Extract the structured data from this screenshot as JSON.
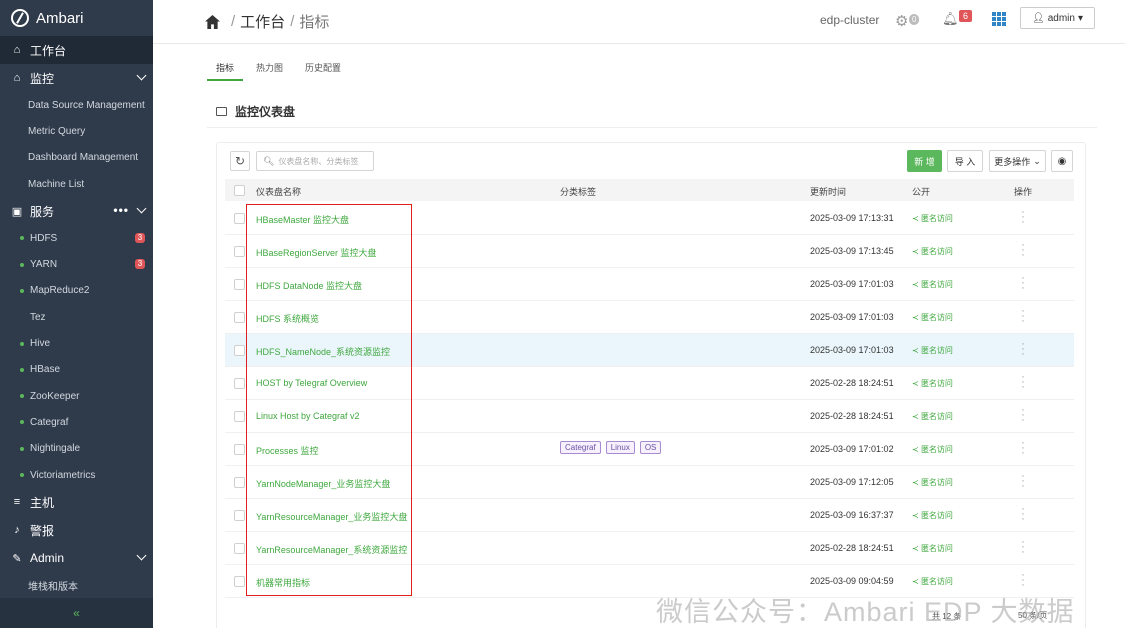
{
  "sidebar": {
    "brand": "Ambari",
    "workbench": "工作台",
    "monitor": "监控",
    "monitor_items": [
      "Data Source Management",
      "Metric Query",
      "Dashboard Management",
      "Machine List"
    ],
    "services": "服务",
    "service_items": [
      {
        "label": "HDFS",
        "badge": "3",
        "dot": true
      },
      {
        "label": "YARN",
        "badge": "3",
        "dot": true
      },
      {
        "label": "MapReduce2",
        "badge": "",
        "dot": true
      },
      {
        "label": "Tez",
        "badge": "",
        "dot": false
      },
      {
        "label": "Hive",
        "badge": "",
        "dot": true
      },
      {
        "label": "HBase",
        "badge": "",
        "dot": true
      },
      {
        "label": "ZooKeeper",
        "badge": "",
        "dot": true
      },
      {
        "label": "Categraf",
        "badge": "",
        "dot": true
      },
      {
        "label": "Nightingale",
        "badge": "",
        "dot": true
      },
      {
        "label": "Victoriametrics",
        "badge": "",
        "dot": true
      }
    ],
    "hosts": "主机",
    "alerts": "警报",
    "admin": "Admin",
    "admin_items": [
      "堆栈和版本"
    ],
    "collapse": "«"
  },
  "header": {
    "crumb_1": "工作台",
    "crumb_2": "指标",
    "sep": "/",
    "cluster": "edp-cluster",
    "gear_count": "0",
    "bell_count": "6",
    "user": "admin"
  },
  "tabs": [
    "指标",
    "热力图",
    "历史配置"
  ],
  "page_title": "监控仪表盘",
  "toolbar": {
    "search_placeholder": "仪表盘名称、分类标签",
    "new": "新 增",
    "import": "导 入",
    "more": "更多操作"
  },
  "table": {
    "headers": {
      "name": "仪表盘名称",
      "tags": "分类标签",
      "updated": "更新时间",
      "public": "公开",
      "ops": "操作"
    },
    "rows": [
      {
        "name": "HBaseMaster 监控大盘",
        "tags": [],
        "updated": "2025-03-09 17:13:31",
        "public": "匿名访问"
      },
      {
        "name": "HBaseRegionServer 监控大盘",
        "tags": [],
        "updated": "2025-03-09 17:13:45",
        "public": "匿名访问"
      },
      {
        "name": "HDFS DataNode 监控大盘",
        "tags": [],
        "updated": "2025-03-09 17:01:03",
        "public": "匿名访问"
      },
      {
        "name": "HDFS 系统概览",
        "tags": [],
        "updated": "2025-03-09 17:01:03",
        "public": "匿名访问"
      },
      {
        "name": "HDFS_NameNode_系统资源监控",
        "tags": [],
        "updated": "2025-03-09 17:01:03",
        "public": "匿名访问"
      },
      {
        "name": "HOST by Telegraf Overview",
        "tags": [],
        "updated": "2025-02-28 18:24:51",
        "public": "匿名访问"
      },
      {
        "name": "Linux Host by Categraf v2",
        "tags": [],
        "updated": "2025-02-28 18:24:51",
        "public": "匿名访问"
      },
      {
        "name": "Processes 监控",
        "tags": [
          "Categraf",
          "Linux",
          "OS"
        ],
        "updated": "2025-03-09 17:01:02",
        "public": "匿名访问"
      },
      {
        "name": "YarnNodeManager_业务监控大盘",
        "tags": [],
        "updated": "2025-03-09 17:12:05",
        "public": "匿名访问"
      },
      {
        "name": "YarnResourceManager_业务监控大盘",
        "tags": [],
        "updated": "2025-03-09 16:37:37",
        "public": "匿名访问"
      },
      {
        "name": "YarnResourceManager_系统资源监控",
        "tags": [],
        "updated": "2025-02-28 18:24:51",
        "public": "匿名访问"
      },
      {
        "name": "机器常用指标",
        "tags": [],
        "updated": "2025-03-09 09:04:59",
        "public": "匿名访问"
      }
    ]
  },
  "footer": {
    "total": "共 12 条",
    "page_size": "50 条/页"
  },
  "watermark": "微信公众号：Ambari EDP 大数据",
  "colors": {
    "accent": "#5cb85c",
    "sidebar": "#2f3a4b",
    "annotation": "#e01f1f"
  }
}
